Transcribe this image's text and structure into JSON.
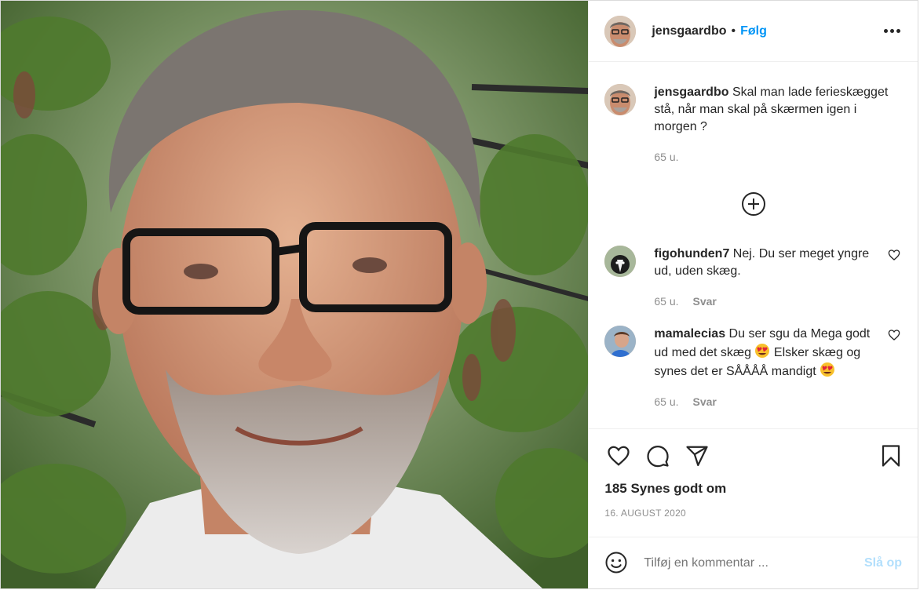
{
  "post": {
    "username": "jensgaardbo",
    "separator": "•",
    "follow_label": "Følg",
    "caption": {
      "username": "jensgaardbo",
      "text": "Skal man lade ferieskægget stå, når man skal på skærmen igen i morgen ?",
      "time": "65 u."
    },
    "comments": [
      {
        "username": "figohunden7",
        "text": "Nej. Du ser meget yngre ud, uden skæg.",
        "time": "65 u.",
        "reply_label": "Svar"
      },
      {
        "username": "mamalecias",
        "text_parts": [
          "Du ser sgu da Mega godt ud med det skæg ",
          " Elsker skæg og synes det er SÅÅÅÅ mandigt "
        ],
        "time": "65 u.",
        "reply_label": "Svar"
      }
    ],
    "likes": "185 Synes godt om",
    "date": "16. AUGUST 2020",
    "comment_placeholder": "Tilføj en kommentar ...",
    "post_label": "Slå op"
  },
  "colors": {
    "accent": "#0095f6",
    "post_disabled": "#b2dffc",
    "muted": "#8e8e8e",
    "text": "#262626"
  },
  "icons": [
    "more-icon",
    "load-more-icon",
    "heart-icon",
    "comment-icon",
    "share-icon",
    "bookmark-icon",
    "emoji-icon",
    "heart-eyes-emoji"
  ]
}
